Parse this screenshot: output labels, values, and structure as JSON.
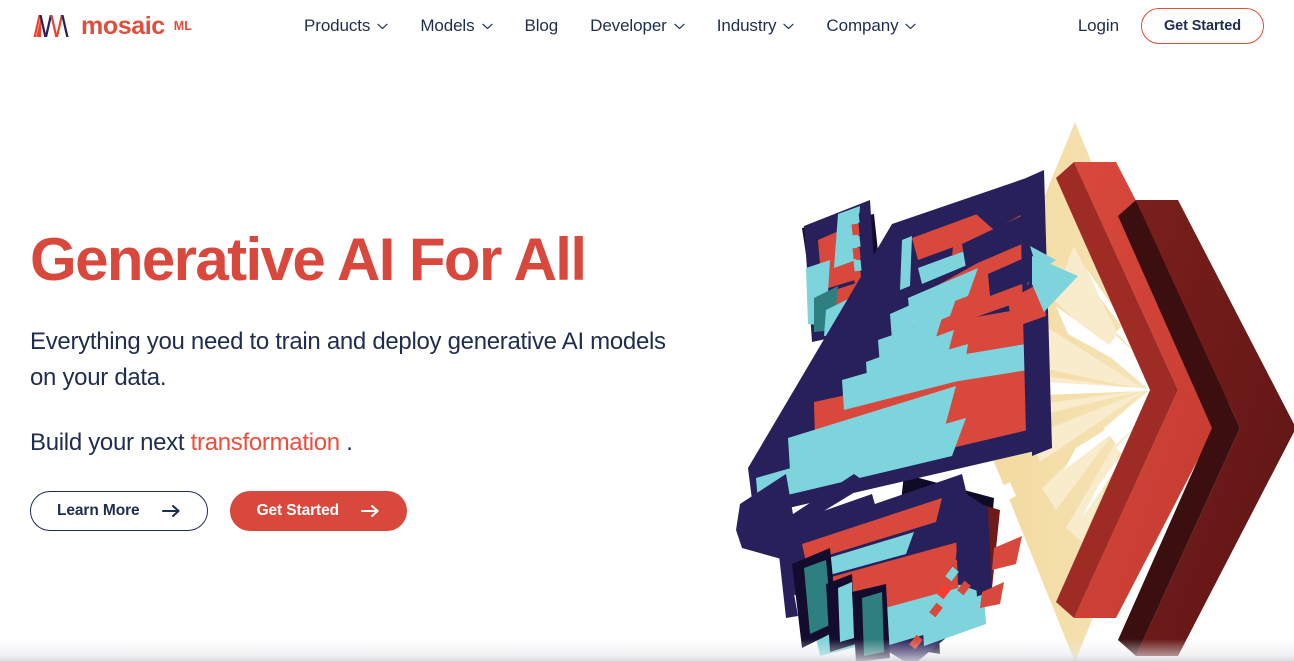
{
  "brand": {
    "name": "mosaic",
    "superscript": "ML",
    "logo_icon": "mosaic-zigzag-logo-icon",
    "red": "#e04e3c",
    "navy": "#28205a"
  },
  "nav": {
    "items": [
      {
        "label": "Products",
        "has_dropdown": true,
        "icon": "chevron-down-icon"
      },
      {
        "label": "Models",
        "has_dropdown": true,
        "icon": "chevron-down-icon"
      },
      {
        "label": "Blog",
        "has_dropdown": false,
        "icon": ""
      },
      {
        "label": "Developer",
        "has_dropdown": true,
        "icon": "chevron-down-icon"
      },
      {
        "label": "Industry",
        "has_dropdown": true,
        "icon": "chevron-down-icon"
      },
      {
        "label": "Company",
        "has_dropdown": true,
        "icon": "chevron-down-icon"
      }
    ],
    "login_label": "Login",
    "get_started_label": "Get Started"
  },
  "hero": {
    "title": "Generative AI For All",
    "subtitle": "Everything you need to train and deploy generative AI models on your data.",
    "build_prefix": "Build your next",
    "build_rotating_word": "transformation",
    "build_period": ".",
    "primary_cta": "Get Started",
    "secondary_cta": "Learn More",
    "arrow_icon": "arrow-right-icon",
    "illustration": "abstract-geometric-crystal-chevron-illustration",
    "colors": {
      "title_red": "#d9483c",
      "text_navy": "#1f2d4e",
      "cta_red": "#d9483c",
      "art_red": "#d9483c",
      "art_dark_red": "#7a1f1c",
      "art_navy": "#28205a",
      "art_cyan": "#7dd4dc",
      "art_teal": "#2e7f80",
      "art_cream": "#f2d89b",
      "art_light_cream": "#f7e9c4"
    }
  }
}
